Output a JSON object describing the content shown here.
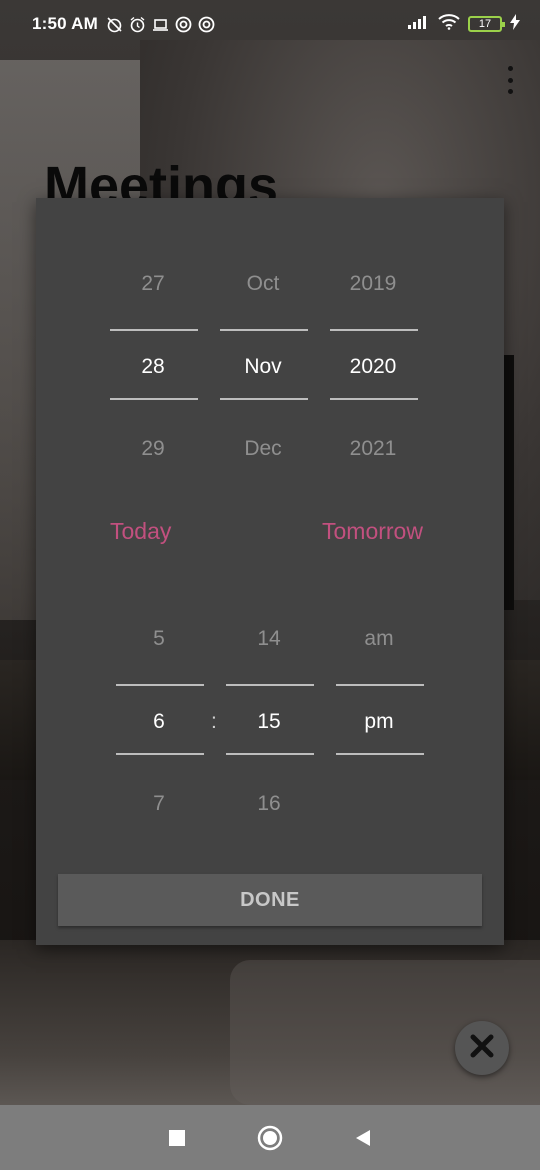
{
  "status_bar": {
    "time": "1:50 AM",
    "battery": "17",
    "icons": [
      "alarm-off-icon",
      "alarm-icon",
      "laptop-icon",
      "circle-icon",
      "circle-icon",
      "signal-icon",
      "wifi-icon",
      "battery-icon",
      "charging-icon"
    ]
  },
  "page": {
    "title": "Meetings"
  },
  "date_picker": {
    "day": {
      "prev": "27",
      "selected": "28",
      "next": "29"
    },
    "month": {
      "prev": "Oct",
      "selected": "Nov",
      "next": "Dec"
    },
    "year": {
      "prev": "2019",
      "selected": "2020",
      "next": "2021"
    }
  },
  "quick_buttons": {
    "today": "Today",
    "tomorrow": "Tomorrow"
  },
  "time_picker": {
    "hour": {
      "prev": "5",
      "selected": "6",
      "next": "7"
    },
    "separator": ":",
    "minute": {
      "prev": "14",
      "selected": "15",
      "next": "16"
    },
    "ampm": {
      "prev": "am",
      "selected": "pm",
      "next": ""
    }
  },
  "done_label": "DONE",
  "colors": {
    "dialog_bg": "#434343",
    "accent": "#c2507f",
    "nav_bar": "#7d7d7d"
  }
}
